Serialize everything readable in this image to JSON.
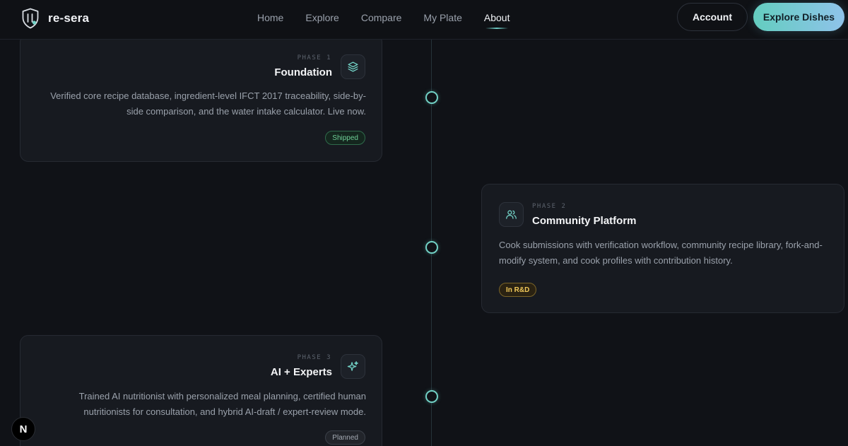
{
  "brand": {
    "name": "re-sera",
    "logo_icon": "shield-utensils-icon"
  },
  "nav": [
    {
      "label": "Home",
      "active": false
    },
    {
      "label": "Explore",
      "active": false
    },
    {
      "label": "Compare",
      "active": false
    },
    {
      "label": "My Plate",
      "active": false
    },
    {
      "label": "About",
      "active": true
    }
  ],
  "header_actions": {
    "account_label": "Account",
    "explore_label": "Explore Dishes"
  },
  "colors": {
    "accent": "#72d2c6",
    "background": "#101217",
    "card": "#171a20"
  },
  "phases": [
    {
      "phase": "PHASE 1",
      "title": "Foundation",
      "icon": "layers-icon",
      "description": "Verified core recipe database, ingredient-level IFCT 2017 traceability, side-by-side comparison, and the water intake calculator. Live now.",
      "status": "Shipped"
    },
    {
      "phase": "PHASE 2",
      "title": "Community Platform",
      "icon": "users-icon",
      "description": "Cook submissions with verification workflow, community recipe library, fork-and-modify system, and cook profiles with contribution history.",
      "status": "In R&D"
    },
    {
      "phase": "PHASE 3",
      "title": "AI + Experts",
      "icon": "sparkles-icon",
      "description": "Trained AI nutritionist with personalized meal planning, certified human nutritionists for consultation, and hybrid AI-draft / expert-review mode.",
      "status": "Planned"
    }
  ],
  "dev_badge": "N"
}
